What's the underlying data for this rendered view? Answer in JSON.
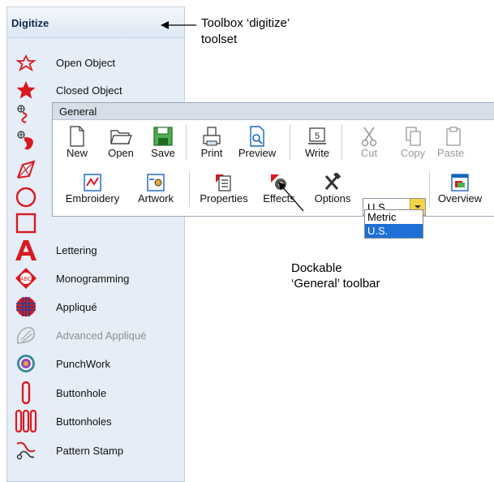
{
  "toolbox": {
    "title": "Digitize",
    "items": [
      {
        "label": "Open Object",
        "icon": "open-object-icon"
      },
      {
        "label": "Closed Object",
        "icon": "closed-object-icon"
      },
      {
        "label": "",
        "icon": "input-a-icon"
      },
      {
        "label": "",
        "icon": "input-b-icon"
      },
      {
        "label": "",
        "icon": "input-c-icon"
      },
      {
        "label": "",
        "icon": "circle-icon"
      },
      {
        "label": "",
        "icon": "rectangle-icon"
      },
      {
        "label": "Lettering",
        "icon": "lettering-icon"
      },
      {
        "label": "Monogramming",
        "icon": "monogramming-icon"
      },
      {
        "label": "Appliqué",
        "icon": "applique-icon"
      },
      {
        "label": "Advanced Appliqué",
        "icon": "advanced-applique-icon",
        "disabled": true
      },
      {
        "label": "PunchWork",
        "icon": "punchwork-icon"
      },
      {
        "label": "Buttonhole",
        "icon": "buttonhole-icon"
      },
      {
        "label": "Buttonholes",
        "icon": "buttonholes-icon"
      },
      {
        "label": "Pattern Stamp",
        "icon": "pattern-stamp-icon"
      }
    ]
  },
  "callouts": {
    "toolbox": [
      "Toolbox ‘digitize’",
      "toolset"
    ],
    "general": [
      "Dockable",
      "‘General’ toolbar"
    ]
  },
  "general_toolbar": {
    "title": "General",
    "row1": [
      {
        "label": "New",
        "icon": "new-icon"
      },
      {
        "label": "Open",
        "icon": "open-folder-icon"
      },
      {
        "label": "Save",
        "icon": "save-icon"
      },
      {
        "label": "Print",
        "icon": "print-icon"
      },
      {
        "label": "Preview",
        "icon": "preview-icon"
      },
      {
        "label": "Write",
        "icon": "write-icon"
      },
      {
        "label": "Cut",
        "icon": "cut-icon",
        "disabled": true
      },
      {
        "label": "Copy",
        "icon": "copy-icon",
        "disabled": true
      },
      {
        "label": "Paste",
        "icon": "paste-icon",
        "disabled": true
      }
    ],
    "row2": [
      {
        "label": "Embroidery",
        "icon": "embroidery-icon"
      },
      {
        "label": "Artwork",
        "icon": "artwork-icon"
      },
      {
        "label": "Properties",
        "icon": "properties-icon"
      },
      {
        "label": "Effects",
        "icon": "effects-icon"
      },
      {
        "label": "Options",
        "icon": "options-icon"
      },
      {
        "label": "Overview",
        "icon": "overview-icon"
      }
    ],
    "units": {
      "selected": "U.S.",
      "options": [
        "Metric",
        "U.S."
      ]
    }
  },
  "colors": {
    "accent_red": "#d81a20",
    "dropdown_selection": "#1e6fd6",
    "toolbox_bg": "#e5edf6"
  }
}
